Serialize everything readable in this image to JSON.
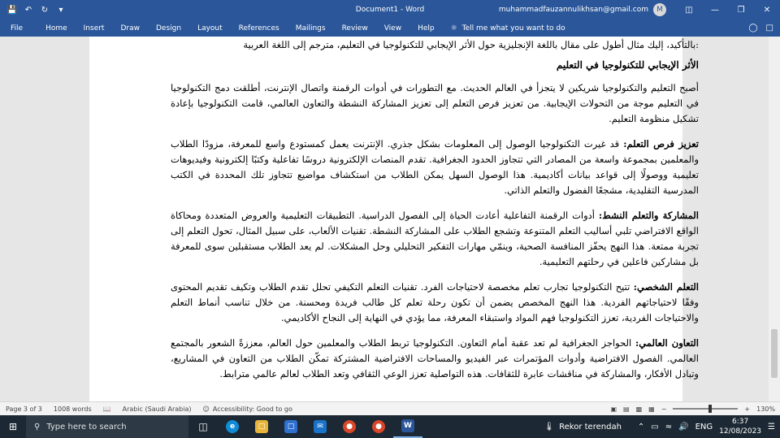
{
  "titlebar": {
    "title": "Document1 - Word",
    "account_email": "muhammadfauzannulikhsan@gmail.com",
    "avatar_initial": "M"
  },
  "ribbon": {
    "tabs": [
      "File",
      "Home",
      "Insert",
      "Draw",
      "Design",
      "Layout",
      "References",
      "Mailings",
      "Review",
      "View",
      "Help"
    ],
    "tell_me": "Tell me what you want to do"
  },
  "document": {
    "intro": ":بالتأكيد، إليك مثال أطول على مقال باللغة الإنجليزية حول الأثر الإيجابي للتكنولوجيا في التعليم، مترجم إلى اللغة العربية",
    "heading": "الأثر الإيجابي للتكنولوجيا في التعليم",
    "paragraphs": [
      {
        "bold": "",
        "text": "أصبح التعليم والتكنولوجيا شريكين لا يتجزأ في العالم الحديث. مع التطورات في أدوات الرقمنة واتصال الإنترنت، أطلقت دمج التكنولوجيا في التعليم موجة من التحولات الإيجابية. من تعزيز فرص التعلم إلى تعزيز المشاركة النشطة والتعاون العالمي، قامت التكنولوجيا بإعادة تشكيل منظومة التعليم."
      },
      {
        "bold": "تعزيز فرص التعلم:",
        "text": " قد غيرت التكنولوجيا الوصول إلى المعلومات بشكل جذري. الإنترنت يعمل كمستودع واسع للمعرفة، مزودًا الطلاب والمعلمين بمجموعة واسعة من المصادر التي تتجاوز الحدود الجغرافية. تقدم المنصات الإلكترونية دروسًا تفاعلية وكتبًا إلكترونية وفيديوهات تعليمية ووصولًا إلى قواعد بيانات أكاديمية. هذا الوصول السهل يمكن الطلاب من استكشاف مواضيع تتجاوز تلك المحددة في الكتب المدرسية التقليدية، مشجعًا الفضول والتعلم الذاتي."
      },
      {
        "bold": "المشاركة والتعلم النشط:",
        "text": " أدوات الرقمنة التفاعلية أعادت الحياة إلى الفصول الدراسية. التطبيقات التعليمية والعروض المتعددة ومحاكاة الواقع الافتراضي تلبي أساليب التعلم المتنوعة وتشجع الطلاب على المشاركة النشطة. تقنيات الألعاب، على سبيل المثال، تحول التعلم إلى تجربة ممتعة. هذا النهج يحفّز المنافسة الصحية، وينمّي مهارات التفكير التحليلي وحل المشكلات. لم يعد الطلاب مستقبلين سوى للمعرفة بل مشاركين فاعلين في رحلتهم التعليمية."
      },
      {
        "bold": "التعلم الشخصي:",
        "text": " تتيح التكنولوجيا تجارب تعلم مخصصة لاحتياجات الفرد. تقنيات التعلم التكيفي تحلل تقدم الطلاب وتكيف تقديم المحتوى وفقًا لاحتياجاتهم الفردية. هذا النهج المخصص يضمن أن تكون رحلة تعلم كل طالب فريدة ومحسنة. من خلال تناسب أنماط التعلم والاحتياجات الفردية، تعزز التكنولوجيا فهم المواد واستبقاء المعرفة، مما يؤدي في النهاية إلى النجاح الأكاديمي."
      },
      {
        "bold": "التعاون العالمي:",
        "text": " الحواجز الجغرافية لم تعد عقبة أمام التعاون. التكنولوجيا تربط الطلاب والمعلمين حول العالم، معززةً الشعور بالمجتمع العالمي. الفصول الافتراضية وأدوات المؤتمرات عبر الفيديو والمساحات الافتراضية المشتركة تمكّن الطلاب من التعاون في المشاريع، وتبادل الأفكار، والمشاركة في مناقشات عابرة للثقافات. هذه التواصلية تعزز الوعي الثقافي وتعد الطلاب لعالم عالمي مترابط."
      }
    ]
  },
  "statusbar": {
    "page": "Page 3 of 3",
    "words": "1008 words",
    "language": "Arabic (Saudi Arabia)",
    "accessibility": "Accessibility: Good to go",
    "zoom": "130%",
    "zoom_level_fraction": 0.55
  },
  "taskbar": {
    "search_placeholder": "Type here to search",
    "weather": "Rekor terendah",
    "language": "ENG",
    "time": "6:37",
    "date": "12/08/2023"
  }
}
